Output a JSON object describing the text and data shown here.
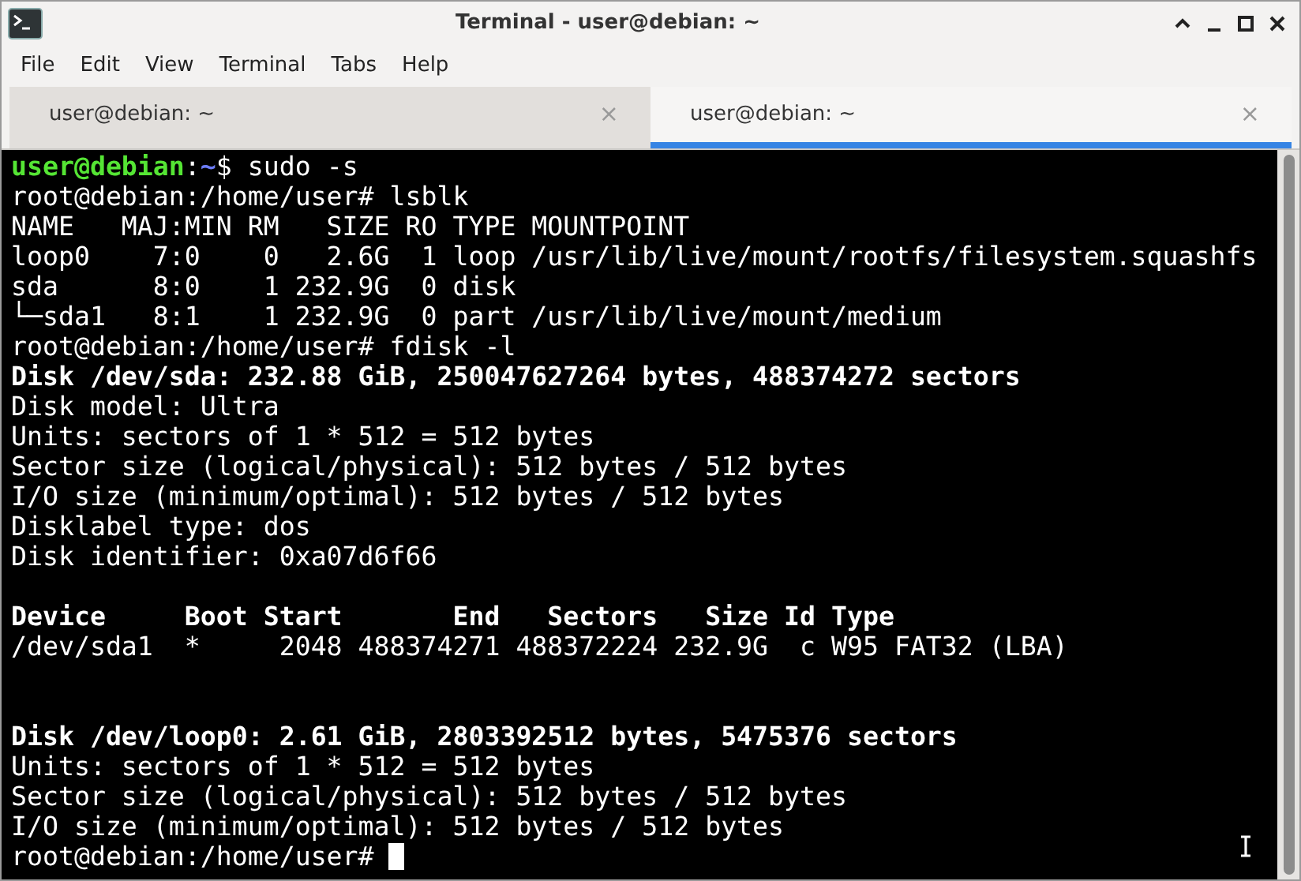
{
  "window": {
    "title": "Terminal - user@debian: ~"
  },
  "menu": [
    "File",
    "Edit",
    "View",
    "Terminal",
    "Tabs",
    "Help"
  ],
  "tabs": [
    {
      "label": "user@debian: ~",
      "selected": false,
      "close": "×"
    },
    {
      "label": "user@debian: ~",
      "selected": true,
      "close": "×"
    }
  ],
  "terminal": {
    "lines": [
      {
        "kind": "user_prompt",
        "user": "user@debian",
        "sep": ":",
        "path": "~",
        "rest": "$ sudo -s"
      },
      {
        "kind": "normal",
        "text": "root@debian:/home/user# lsblk"
      },
      {
        "kind": "normal",
        "text": "NAME   MAJ:MIN RM   SIZE RO TYPE MOUNTPOINT"
      },
      {
        "kind": "normal",
        "text": "loop0    7:0    0   2.6G  1 loop /usr/lib/live/mount/rootfs/filesystem.squashfs"
      },
      {
        "kind": "normal",
        "text": "sda      8:0    1 232.9G  0 disk"
      },
      {
        "kind": "normal",
        "text": "└─sda1   8:1    1 232.9G  0 part /usr/lib/live/mount/medium"
      },
      {
        "kind": "normal",
        "text": "root@debian:/home/user# fdisk -l"
      },
      {
        "kind": "bold",
        "text": "Disk /dev/sda: 232.88 GiB, 250047627264 bytes, 488374272 sectors"
      },
      {
        "kind": "normal",
        "text": "Disk model: Ultra"
      },
      {
        "kind": "normal",
        "text": "Units: sectors of 1 * 512 = 512 bytes"
      },
      {
        "kind": "normal",
        "text": "Sector size (logical/physical): 512 bytes / 512 bytes"
      },
      {
        "kind": "normal",
        "text": "I/O size (minimum/optimal): 512 bytes / 512 bytes"
      },
      {
        "kind": "normal",
        "text": "Disklabel type: dos"
      },
      {
        "kind": "normal",
        "text": "Disk identifier: 0xa07d6f66"
      },
      {
        "kind": "blank"
      },
      {
        "kind": "bold",
        "text": "Device     Boot Start       End   Sectors   Size Id Type"
      },
      {
        "kind": "normal",
        "text": "/dev/sda1  *     2048 488374271 488372224 232.9G  c W95 FAT32 (LBA)"
      },
      {
        "kind": "blank"
      },
      {
        "kind": "blank"
      },
      {
        "kind": "bold",
        "text": "Disk /dev/loop0: 2.61 GiB, 2803392512 bytes, 5475376 sectors"
      },
      {
        "kind": "normal",
        "text": "Units: sectors of 1 * 512 = 512 bytes"
      },
      {
        "kind": "normal",
        "text": "Sector size (logical/physical): 512 bytes / 512 bytes"
      },
      {
        "kind": "normal",
        "text": "I/O size (minimum/optimal): 512 bytes / 512 bytes"
      },
      {
        "kind": "cursor_prompt",
        "text": "root@debian:/home/user#"
      }
    ]
  }
}
